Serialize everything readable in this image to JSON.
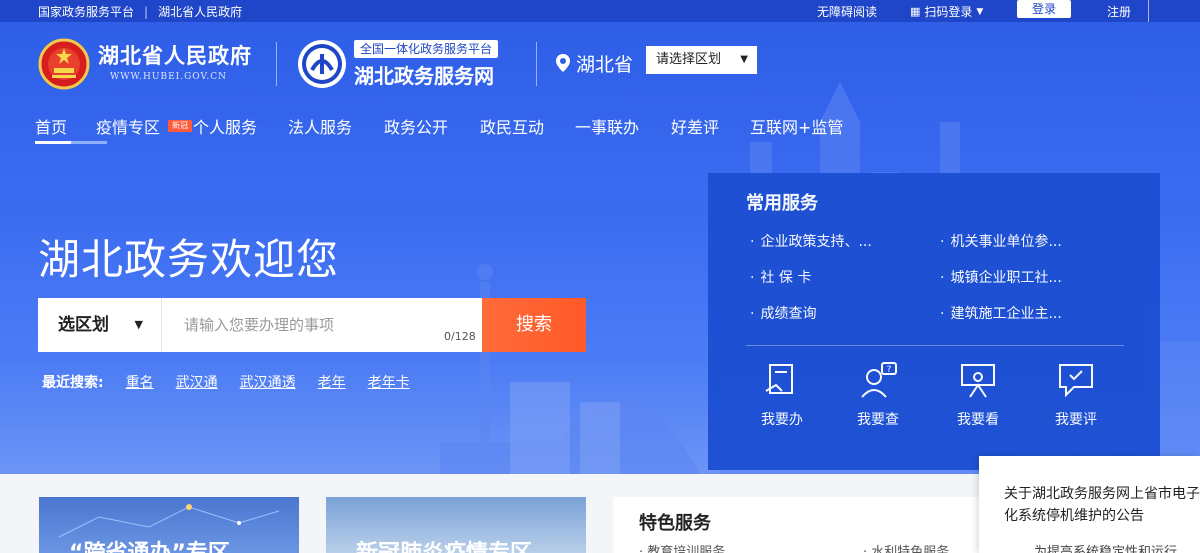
{
  "topbar": {
    "national_platform": "国家政务服务平台",
    "provincial_gov": "湖北省人民政府",
    "accessible_reading": "无障碍阅读",
    "scan_login": "扫码登录",
    "login": "登录",
    "register": "注册"
  },
  "header": {
    "gov_title": "湖北省人民政府",
    "gov_url": "WWW.HUBEI.GOV.CN",
    "platform_tag": "全国一体化政务服务平台",
    "platform_title": "湖北政务服务网",
    "province": "湖北省",
    "region_select": "请选择区划"
  },
  "nav": {
    "items": [
      "首页",
      "疫情专区",
      "个人服务",
      "法人服务",
      "政务公开",
      "政民互动",
      "一事联办",
      "好差评",
      "互联网+监管"
    ],
    "badge": "新冠"
  },
  "hero": {
    "welcome": "湖北政务欢迎您",
    "search_region": "选区划",
    "search_placeholder": "请输入您要办理的事项",
    "search_count": "0/128",
    "search_button": "搜索",
    "recent_label": "最近搜索:",
    "recent_keywords": [
      "重名",
      "武汉通",
      "武汉通透",
      "老年",
      "老年卡"
    ]
  },
  "common_services": {
    "title": "常用服务",
    "items": [
      "企业政策支持、...",
      "机关事业单位参...",
      "社 保 卡",
      "城镇企业职工社...",
      "成绩查询",
      "建筑施工企业主..."
    ],
    "quick": [
      "我要办",
      "我要查",
      "我要看",
      "我要评"
    ]
  },
  "lower": {
    "card1_title": "“跨省通办”专区",
    "card2_title": "新冠肺炎疫情专区",
    "special_title": "特色服务",
    "special_items": [
      "· 教育培训服务",
      "· 水利特色服务"
    ],
    "notice_text": "关于湖北政务服务网上省市电子化系统停机维护的公告",
    "notice_sub": "为提高系统稳定性和运行"
  },
  "colors": {
    "brand_blue": "#1f46c8",
    "search_orange": "#ff5a28",
    "panel_blue": "#1c4fd2"
  }
}
